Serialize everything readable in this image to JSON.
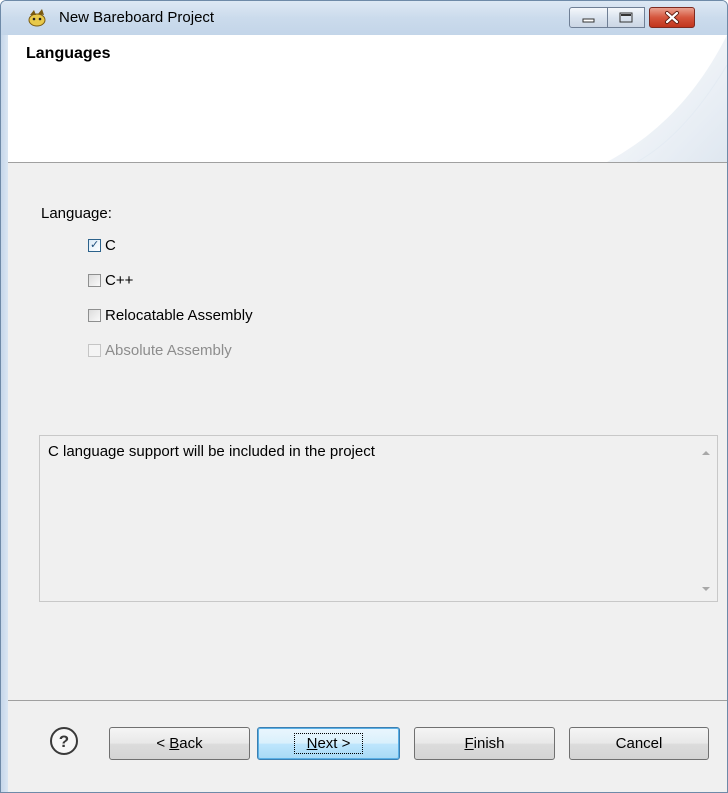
{
  "window": {
    "title": "New Bareboard Project",
    "controls": [
      "minimize",
      "maximize",
      "close"
    ]
  },
  "banner": {
    "title": "Languages"
  },
  "language_group": {
    "label": "Language:",
    "options": [
      {
        "label": "C",
        "checked": true,
        "enabled": true
      },
      {
        "label": "C++",
        "checked": false,
        "enabled": true
      },
      {
        "label": "Relocatable Assembly",
        "checked": false,
        "enabled": true
      },
      {
        "label": "Absolute Assembly",
        "checked": false,
        "enabled": false
      }
    ]
  },
  "description": {
    "text": "C language support will be included in the project"
  },
  "buttons": {
    "help_icon": "help-icon",
    "back": {
      "prefix": "< ",
      "mnemonic": "B",
      "rest": "ack"
    },
    "next": {
      "mnemonic": "N",
      "rest": "ext >"
    },
    "finish": {
      "mnemonic": "F",
      "rest": "inish"
    },
    "cancel": "Cancel"
  },
  "colors": {
    "close_button": "#c1351d",
    "default_button_border": "#3c7fb1",
    "check_mark": "#1e4f7d"
  }
}
